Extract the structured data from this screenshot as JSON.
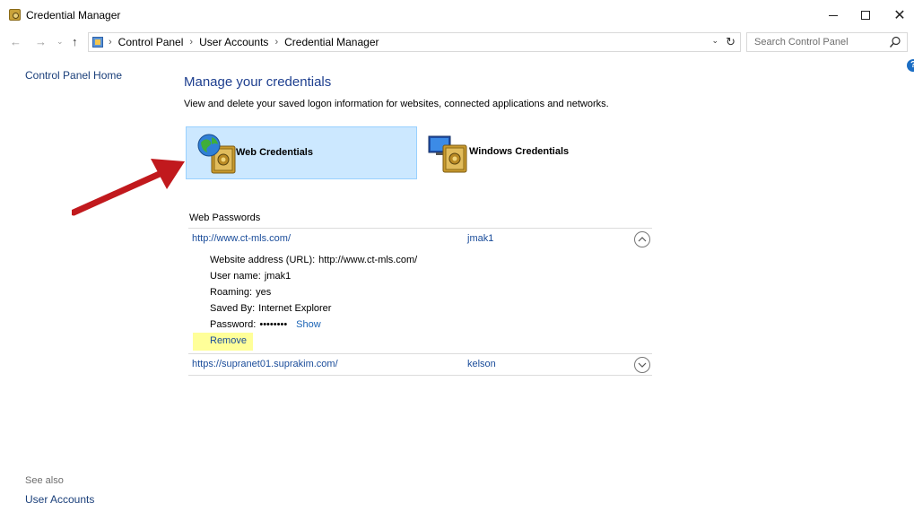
{
  "window": {
    "title": "Credential Manager",
    "minimize_glyph": "—",
    "close_glyph": "✕"
  },
  "nav": {
    "back_glyph": "←",
    "forward_glyph": "→",
    "recent_glyph": "⌄",
    "up_glyph": "↑",
    "breadcrumb": [
      "Control Panel",
      "User Accounts",
      "Credential Manager"
    ],
    "separator": "›",
    "dropdown_glyph": "⌄",
    "refresh_glyph": "↻"
  },
  "search": {
    "placeholder": "Search Control Panel"
  },
  "help": {
    "glyph": "?"
  },
  "left_pane": {
    "home_link": "Control Panel Home",
    "see_also": "See also",
    "user_accounts_link": "User Accounts"
  },
  "main": {
    "heading": "Manage your credentials",
    "subheading": "View and delete your saved logon information for websites, connected applications and networks.",
    "tiles": [
      {
        "label": "Web Credentials",
        "selected": true
      },
      {
        "label": "Windows Credentials",
        "selected": false
      }
    ],
    "section_title": "Web Passwords",
    "credentials": [
      {
        "url": "http://www.ct-mls.com/",
        "user": "jmak1",
        "expanded": true,
        "details": {
          "website_label": "Website address (URL):",
          "website_value": "http://www.ct-mls.com/",
          "username_label": "User name:",
          "username_value": "jmak1",
          "roaming_label": "Roaming:",
          "roaming_value": "yes",
          "savedby_label": "Saved By:",
          "savedby_value": "Internet Explorer",
          "password_label": "Password:",
          "password_value": "••••••••",
          "show_link": "Show",
          "remove_link": "Remove"
        }
      },
      {
        "url": "https://supranet01.suprakim.com/",
        "user": "kelson",
        "expanded": false
      }
    ]
  },
  "colors": {
    "link": "#1a4c9a",
    "heading": "#1e3f8f",
    "tile_selected_bg": "#cce8ff",
    "highlight": "#ffff99",
    "arrow": "#c1191d"
  }
}
